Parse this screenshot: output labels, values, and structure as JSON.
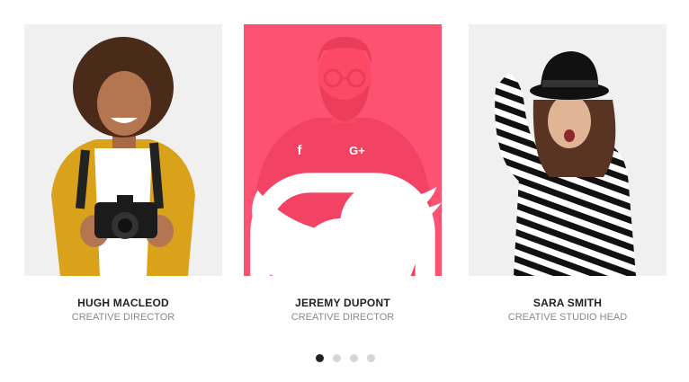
{
  "team": {
    "members": [
      {
        "name": "HUGH MACLEOD",
        "role": "CREATIVE DIRECTOR"
      },
      {
        "name": "JEREMY DUPONT",
        "role": "CREATIVE DIRECTOR"
      },
      {
        "name": "SARA SMITH",
        "role": "CREATIVE STUDIO HEAD"
      }
    ],
    "social_icons": [
      "facebook-icon",
      "twitter-icon",
      "google-plus-icon",
      "instagram-icon"
    ],
    "social_glyphs": {
      "facebook": "f",
      "google_plus": "G+"
    },
    "hover_overlay_color": "#ff4064",
    "pagination": {
      "total": 4,
      "active": 1
    }
  }
}
